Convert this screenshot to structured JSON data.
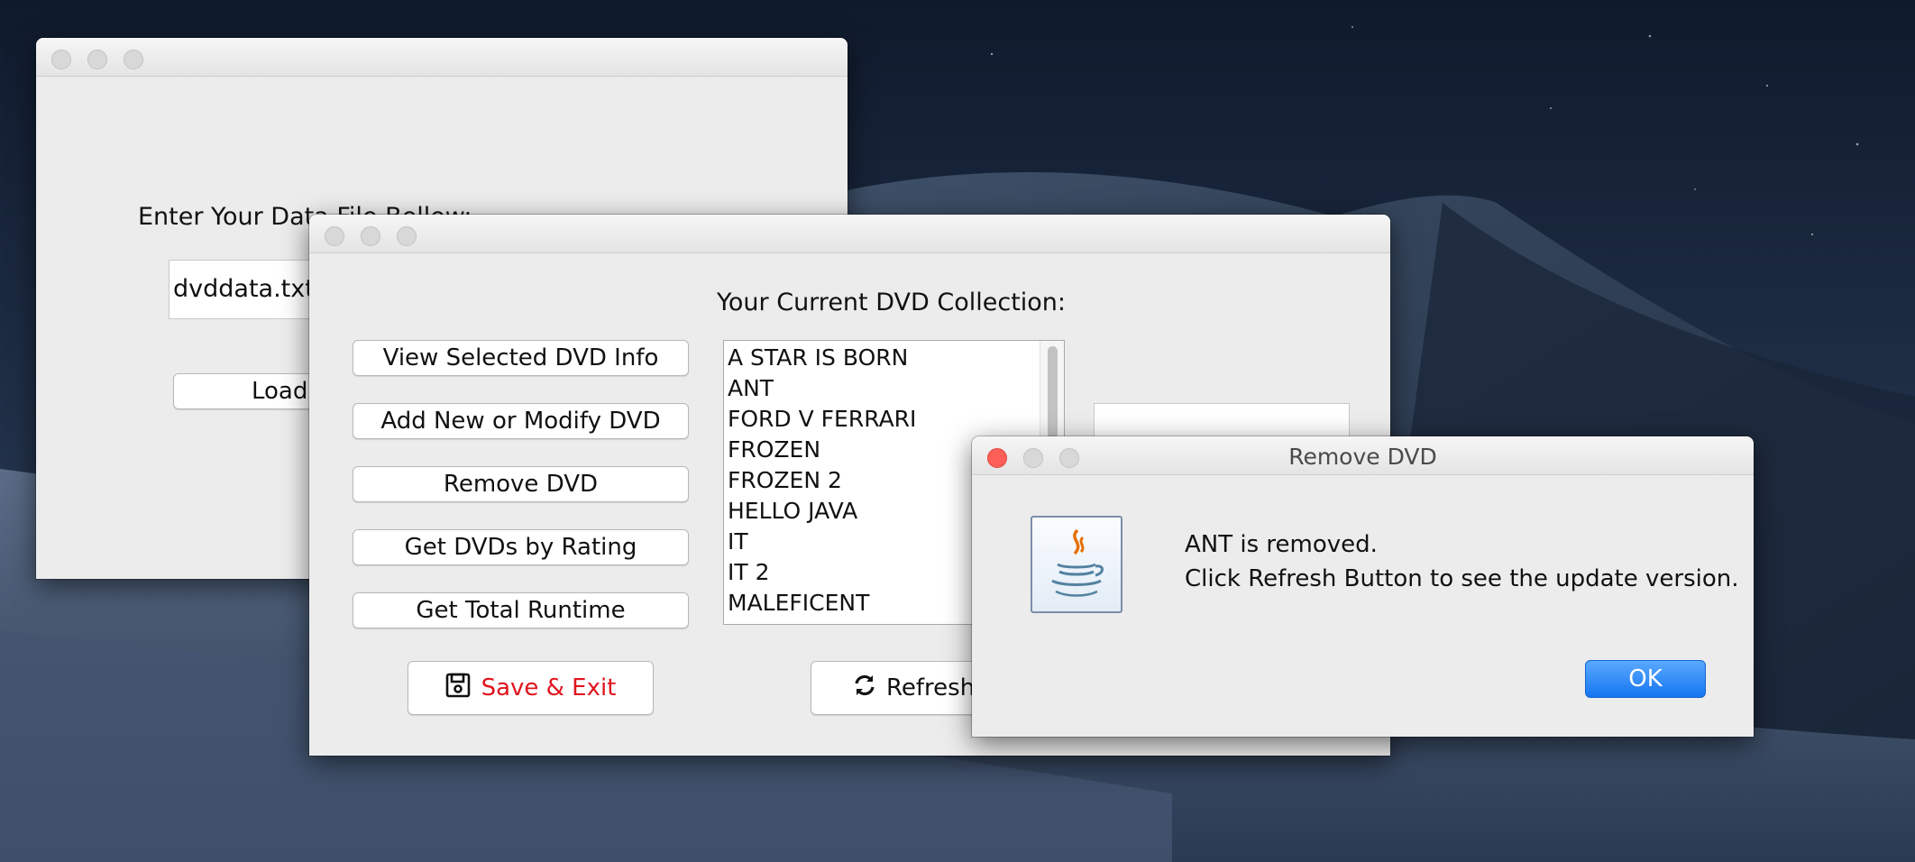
{
  "loader_window": {
    "prompt_label": "Enter Your Data File Bellow:",
    "file_input_value": "dvddata.txt",
    "load_button_label": "Load File"
  },
  "main_window": {
    "heading": "Your Current DVD Collection:",
    "buttons": {
      "view_info": "View Selected DVD Info",
      "add_modify": "Add New or Modify DVD",
      "remove": "Remove DVD",
      "by_rating": "Get DVDs by Rating",
      "total_runtime": "Get Total Runtime",
      "save_exit": "Save & Exit",
      "refresh": "Refresh"
    },
    "dvd_list": [
      "A STAR IS BORN",
      "ANT",
      "FORD V FERRARI",
      "FROZEN",
      "FROZEN 2",
      "HELLO JAVA",
      "IT",
      "IT 2",
      "MALEFICENT"
    ],
    "save_exit_color": "#e0141e"
  },
  "dialog": {
    "title": "Remove DVD",
    "message_line1": "ANT is removed.",
    "message_line2": "Click Refresh Button to see the update version.",
    "ok_label": "OK",
    "icon": "java-icon"
  }
}
